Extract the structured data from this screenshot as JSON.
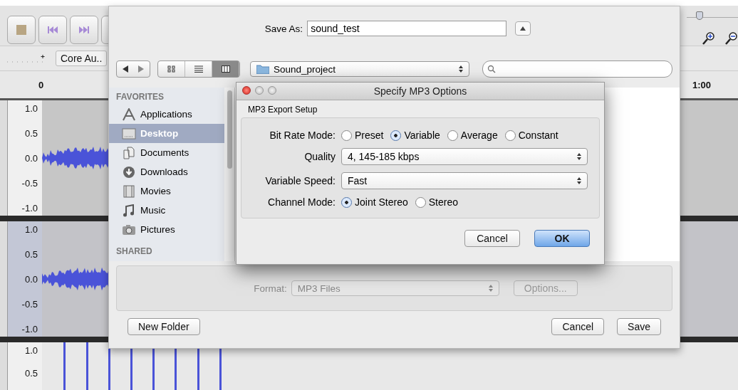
{
  "app": {
    "zoom_slider": {
      "level": 0.25
    },
    "device": "Core Au..",
    "timeline": {
      "start": "0",
      "end": "1:00"
    },
    "tracks": [
      {
        "selected": false,
        "kind": "wave",
        "scale": [
          "1.0",
          "0.5",
          "0.0",
          "-0.5",
          "-1.0"
        ]
      },
      {
        "selected": true,
        "kind": "wave",
        "scale": [
          "1.0",
          "0.5",
          "0.0",
          "-0.5",
          "-1.0"
        ]
      },
      {
        "selected": false,
        "kind": "clicks",
        "scale": [
          "1.0",
          "0.5"
        ]
      }
    ]
  },
  "save_sheet": {
    "save_as_label": "Save As:",
    "filename": "sound_test",
    "view_modes": [
      {
        "selected": false
      },
      {
        "selected": false
      },
      {
        "selected": true
      }
    ],
    "location": "Sound_project",
    "sidebar": [
      {
        "heading": "FAVORITES",
        "items": [
          {
            "label": "Applications",
            "selected": false
          },
          {
            "label": "Desktop",
            "selected": true
          },
          {
            "label": "Documents",
            "selected": false
          },
          {
            "label": "Downloads",
            "selected": false
          },
          {
            "label": "Movies",
            "selected": false
          },
          {
            "label": "Music",
            "selected": false
          },
          {
            "label": "Pictures",
            "selected": false
          }
        ]
      },
      {
        "heading": "SHARED"
      }
    ],
    "format": {
      "label": "Format:",
      "value": "MP3 Files",
      "disabled": true
    },
    "options_button": {
      "label": "Options...",
      "disabled": true
    },
    "new_folder_button": "New Folder",
    "cancel_button": "Cancel",
    "save_button": "Save"
  },
  "mp3_dialog": {
    "title": "Specify MP3 Options",
    "group": "MP3 Export Setup",
    "rows": [
      {
        "kind": "radio",
        "label": "Bit Rate Mode:",
        "options": [
          {
            "label": "Preset",
            "selected": false
          },
          {
            "label": "Variable",
            "selected": true
          },
          {
            "label": "Average",
            "selected": false
          },
          {
            "label": "Constant",
            "selected": false
          }
        ]
      },
      {
        "kind": "select",
        "label": "Quality",
        "value": "4, 145-185 kbps"
      },
      {
        "kind": "select",
        "label": "Variable Speed:",
        "value": "Fast"
      },
      {
        "kind": "radio",
        "label": "Channel Mode:",
        "options": [
          {
            "label": "Joint Stereo",
            "selected": true
          },
          {
            "label": "Stereo",
            "selected": false
          }
        ]
      }
    ],
    "buttons": [
      {
        "label": "Cancel",
        "default": false
      },
      {
        "label": "OK",
        "default": true
      }
    ]
  }
}
